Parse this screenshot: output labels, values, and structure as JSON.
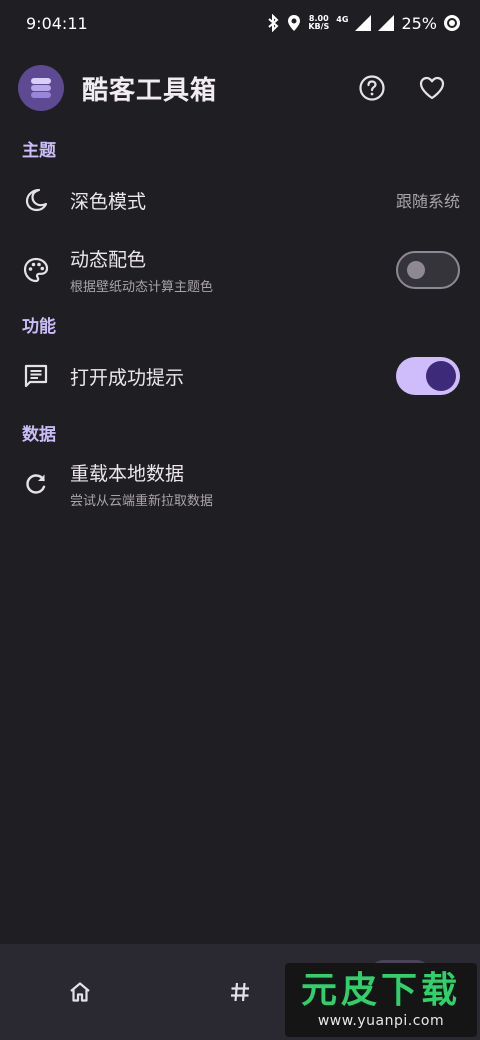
{
  "status_bar": {
    "time": "9:04:11",
    "net_speed_value": "8.00",
    "net_speed_unit": "KB/S",
    "network_type": "4G",
    "battery": "25%"
  },
  "app_bar": {
    "title": "酷客工具箱",
    "icons": [
      "help-icon",
      "heart-icon"
    ]
  },
  "sections": {
    "theme": {
      "header": "主题",
      "dark_mode": {
        "title": "深色模式",
        "value": "跟随系统",
        "icon": "moon-icon"
      },
      "dynamic_color": {
        "title": "动态配色",
        "subtitle": "根据壁纸动态计算主题色",
        "icon": "palette-icon",
        "enabled": false
      }
    },
    "feature": {
      "header": "功能",
      "success_tip": {
        "title": "打开成功提示",
        "icon": "message-icon",
        "enabled": true
      }
    },
    "data": {
      "header": "数据",
      "reload": {
        "title": "重载本地数据",
        "subtitle": "尝试从云端重新拉取数据",
        "icon": "refresh-icon"
      }
    }
  },
  "bottom_nav": {
    "items": [
      "home-icon",
      "hash-icon",
      "settings-icon"
    ]
  },
  "watermark": {
    "title": "元皮下载",
    "url": "www.yuanpi.com"
  },
  "colors": {
    "background": "#1f1e22",
    "accent": "#cbbdf7",
    "switch_on_track": "#cfbdfb",
    "switch_on_thumb": "#3d2a78",
    "nav_background": "#2a2830"
  }
}
